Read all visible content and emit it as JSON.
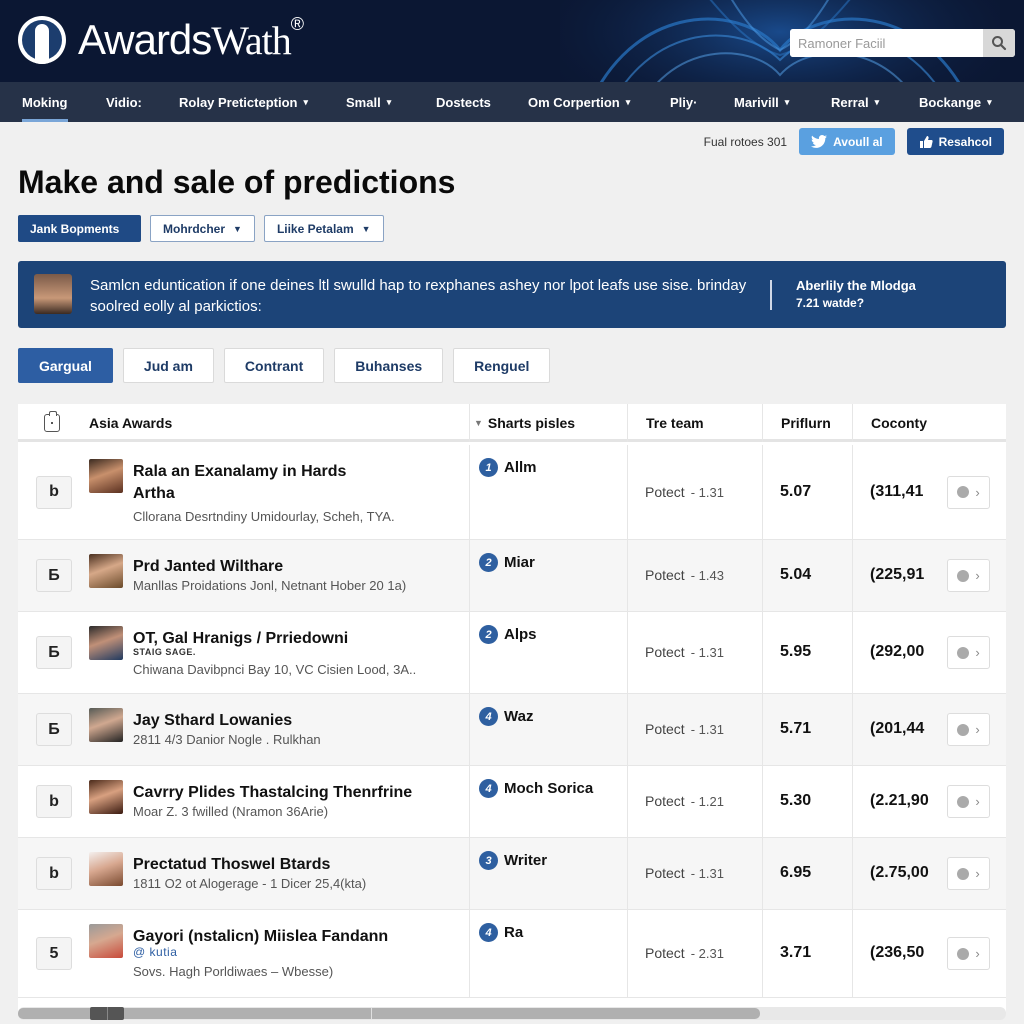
{
  "header": {
    "brand_sans": "Awards",
    "brand_serif": "Wath",
    "brand_mark": "®",
    "search_placeholder": "Ramoner Faciil"
  },
  "nav": {
    "items": [
      {
        "label": "Moking",
        "dropdown": false,
        "active": true
      },
      {
        "label": "Vidio:",
        "dropdown": false
      },
      {
        "label": "Rolay Preticteption",
        "dropdown": true
      },
      {
        "label": "Small",
        "dropdown": true
      },
      {
        "label": "Dostects",
        "dropdown": false
      },
      {
        "label": "Om Corpertion",
        "dropdown": true
      },
      {
        "label": "Pliy·",
        "dropdown": false
      },
      {
        "label": "Marivill",
        "dropdown": true
      },
      {
        "label": "Rerral",
        "dropdown": true
      },
      {
        "label": "Bockange",
        "dropdown": true
      }
    ],
    "chevron": "⌄"
  },
  "share": {
    "count_label": "Fual rotoes 301",
    "twitter_label": "Avoull al",
    "facebook_label": "Resahcol"
  },
  "page": {
    "title": "Make and sale of predictions"
  },
  "filters": {
    "primary_label": "Jank Bopments",
    "dropdown1_label": "Mohrdcher",
    "dropdown2_label": "Liike Petalam",
    "caret": "▼"
  },
  "banner": {
    "message": "Samlcn eduntication if one deines ltl swulld hap to rexphanes ashey nor lpot leafs use sise. brinday soolred eolly al parkictios:",
    "side_title": "Aberlily the Mlodga",
    "side_subtitle": "7.21 watde?"
  },
  "tabs": [
    {
      "label": "Gargual",
      "active": true
    },
    {
      "label": "Jud am"
    },
    {
      "label": "Contrant"
    },
    {
      "label": "Buhanses"
    },
    {
      "label": "Renguel"
    }
  ],
  "table": {
    "columns": {
      "awards": "Asia Awards",
      "picks": "Sharts pisles",
      "team": "Tre team",
      "score": "Priflurn",
      "count": "Coconty"
    },
    "sort_indicator": "▼",
    "rows": [
      {
        "rank": "b",
        "title": "Rala an Exanalamy in Hards Artha",
        "tag": "",
        "subtitle": "Cllorana Desrtndiny Umidourlay, Scheh, TYA.",
        "pick_num": "1",
        "pick_label": "Allm",
        "team": "Potect",
        "delta": "- 1.31",
        "score": "5.07",
        "count": "(311,41",
        "avatar_colors": [
          "#3a2a20",
          "#c8906c",
          "#5a3020"
        ]
      },
      {
        "rank": "Б",
        "title": "Prd Janted Wilthare",
        "tag": "",
        "subtitle": "Manllas Proidations Jonl, Netnant Hober 20 1a)",
        "pick_num": "2",
        "pick_label": "Miar",
        "team": "Potect",
        "delta": "- 1.43",
        "score": "5.04",
        "count": "(225,91",
        "avatar_colors": [
          "#4a3020",
          "#d6a888",
          "#6a4a2a"
        ]
      },
      {
        "rank": "Б",
        "title": "OT, Gal Hranigs / Prriedowni",
        "tag": "STAIG SAGE.",
        "subtitle": "Chiwana Davibpnci Bay 10, VC Cisien Lood, 3A..",
        "pick_num": "2",
        "pick_label": "Alps",
        "team": "Potect",
        "delta": "- 1.31",
        "score": "5.95",
        "count": "(292,00",
        "avatar_colors": [
          "#2a2a2a",
          "#c09078",
          "#203a60"
        ]
      },
      {
        "rank": "Б",
        "title": "Jay Sthard Lowanies",
        "tag": "",
        "subtitle": "2811 4/3 Danior Nogle . Rulkhan",
        "pick_num": "4",
        "pick_label": "Waz",
        "team": "Potect",
        "delta": "- 1.31",
        "score": "5.71",
        "count": "(201,44",
        "avatar_colors": [
          "#555a55",
          "#d0a890",
          "#222222"
        ]
      },
      {
        "rank": "b",
        "title": "Cavrry Plides Thastalcing Thenrfrine",
        "tag": "",
        "subtitle": "Moar Z. 3 fwilled (Nramon 36Arie)",
        "pick_num": "4",
        "pick_label": "Moch Sorica",
        "team": "Potect",
        "delta": "- 1.21",
        "score": "5.30",
        "count": "(2.21,90",
        "avatar_colors": [
          "#4a2a1a",
          "#d8a080",
          "#3a1a10"
        ]
      },
      {
        "rank": "b",
        "title": "Prectatud Thoswel Btards",
        "tag": "",
        "subtitle": "1811 O2 ot Alogerage - 1 Dicer 25,4(kta)",
        "pick_num": "3",
        "pick_label": "Writer",
        "team": "Potect",
        "delta": "- 1.31",
        "score": "6.95",
        "count": "(2.75,00",
        "avatar_colors": [
          "#f4f0ee",
          "#d8a890",
          "#7a4a30"
        ]
      },
      {
        "rank": "5",
        "title": "Gayori (nstalicn) Miislea Fandann",
        "tag": "@ kutia",
        "subtitle": "Sovs. Hagh Porldiwaes – Wbesse)",
        "pick_num": "4",
        "pick_label": "Ra",
        "team": "Potect",
        "delta": "- 2.31",
        "score": "3.71",
        "count": "(236,50",
        "avatar_colors": [
          "#9a9a9a",
          "#d6a890",
          "#c84a3a"
        ]
      }
    ]
  },
  "colors": {
    "header_bg": "#0b1733",
    "nav_bg": "#263248",
    "accent": "#1f4a85",
    "banner_bg": "#1c4478",
    "badge": "#2e5fa0",
    "twitter": "#5aa0e0"
  }
}
